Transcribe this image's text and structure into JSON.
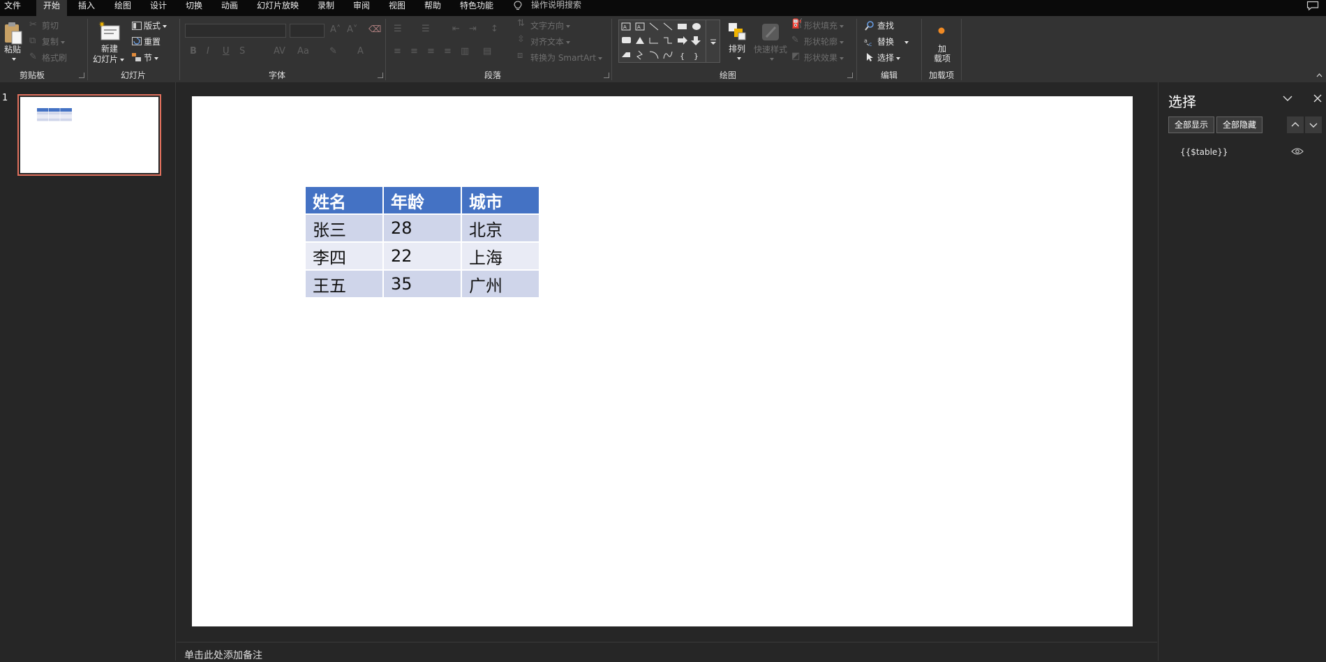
{
  "menu": {
    "tabs": [
      "文件",
      "开始",
      "插入",
      "绘图",
      "设计",
      "切换",
      "动画",
      "幻灯片放映",
      "录制",
      "审阅",
      "视图",
      "帮助",
      "特色功能"
    ],
    "active_tab": "开始",
    "search_placeholder": "操作说明搜索"
  },
  "ribbon": {
    "clipboard": {
      "paste": "粘贴",
      "cut": "剪切",
      "copy": "复制",
      "format_painter": "格式刷",
      "label": "剪贴板"
    },
    "slides": {
      "new_slide_1": "新建",
      "new_slide_2": "幻灯片",
      "layout": "版式",
      "reset": "重置",
      "section": "节",
      "label": "幻灯片"
    },
    "font": {
      "label": "字体"
    },
    "paragraph": {
      "text_direction": "文字方向",
      "align_text": "对齐文本",
      "convert_smartart": "转换为 SmartArt",
      "label": "段落"
    },
    "drawing": {
      "arrange": "排列",
      "quick_styles": "快速样式",
      "shape_fill": "形状填充",
      "shape_outline": "形状轮廓",
      "shape_effects": "形状效果",
      "label": "绘图"
    },
    "editing": {
      "find": "查找",
      "replace": "替换",
      "select": "选择",
      "label": "编辑"
    },
    "addins": {
      "addin_1": "加",
      "addin_2": "载项",
      "label": "加载项"
    }
  },
  "thumbnails": {
    "slide_number": "1"
  },
  "slide_table": {
    "headers": [
      "姓名",
      "年龄",
      "城市"
    ],
    "rows": [
      [
        "张三",
        "28",
        "北京"
      ],
      [
        "李四",
        "22",
        "上海"
      ],
      [
        "王五",
        "35",
        "广州"
      ]
    ],
    "colors": {
      "header": "#4472c4",
      "row_odd": "#cfd5ea",
      "row_even": "#e9ebf5"
    }
  },
  "notes": {
    "placeholder": "单击此处添加备注"
  },
  "selection_pane": {
    "title": "选择",
    "show_all": "全部显示",
    "hide_all": "全部隐藏",
    "item": "{{$table}}"
  },
  "accent_colors": {
    "thumb_border": "#e0705d",
    "addin_dot": "#f08a24"
  }
}
